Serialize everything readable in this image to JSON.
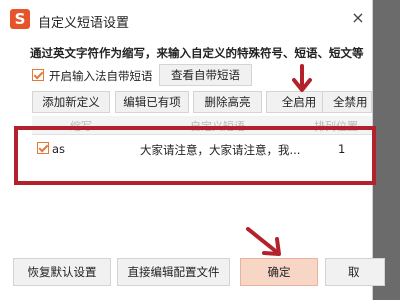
{
  "window": {
    "title": "自定义短语设置",
    "app_icon": "sogou-logo-icon",
    "close_glyph": "×",
    "accent": "#e8542a"
  },
  "description": "通过英文字符作为缩写，来输入自定义的特殊符号、短语、短文等",
  "enable_builtin": {
    "label": "开启输入法自带短语",
    "checked": true
  },
  "buttons": {
    "view_builtin": "查看自带短语",
    "add": "添加新定义",
    "edit": "编辑已有项",
    "delete": "删除高亮",
    "enable_all": "全启用",
    "disable_all": "全禁用",
    "restore_default": "恢复默认设置",
    "edit_config": "直接编辑配置文件",
    "ok": "确定",
    "cancel": "取"
  },
  "table": {
    "headers": [
      "缩写",
      "自定义短语",
      "排列位置"
    ],
    "rows": [
      {
        "checked": true,
        "abbr": "as",
        "phrase": "大家请注意，大家请注意，我...",
        "position": "1"
      }
    ]
  },
  "annotation_color": "#b3212b"
}
